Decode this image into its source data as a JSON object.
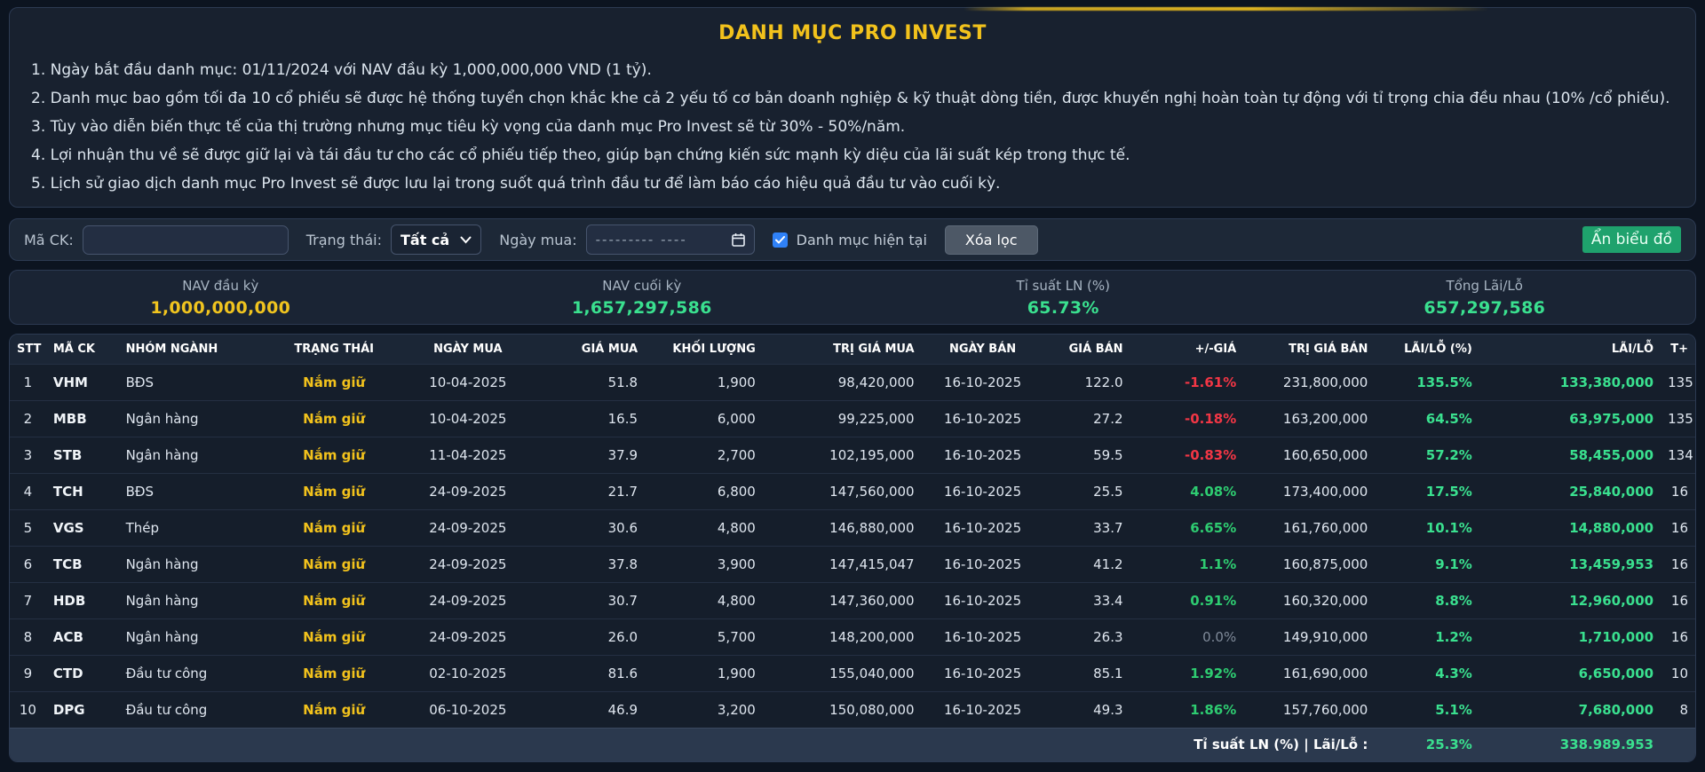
{
  "title": "DANH MỤC PRO INVEST",
  "notes": [
    "1. Ngày bắt đầu danh mục: 01/11/2024 với NAV đầu kỳ 1,000,000,000 VND (1 tỷ).",
    "2. Danh mục bao gồm tối đa 10 cổ phiếu sẽ được hệ thống tuyển chọn khắc khe cả 2 yếu tố cơ bản doanh nghiệp & kỹ thuật dòng tiền, được khuyến nghị hoàn toàn tự động với tỉ trọng chia đều nhau (10% /cổ phiếu).",
    "3. Tùy vào diễn biến thực tế của thị trường nhưng mục tiêu kỳ vọng của danh mục Pro Invest sẽ từ 30% - 50%/năm.",
    "4. Lợi nhuận thu về sẽ được giữ lại và tái đầu tư cho các cổ phiếu tiếp theo, giúp bạn chứng kiến sức mạnh kỳ diệu của lãi suất kép trong thực tế.",
    "5. Lịch sử giao dịch danh mục Pro Invest sẽ được lưu lại trong suốt quá trình đầu tư để làm báo cáo hiệu quả đầu tư vào cuối kỳ."
  ],
  "filter": {
    "ticker_label": "Mã CK:",
    "ticker_value": "",
    "status_label": "Trạng thái:",
    "status_value": "Tất cả",
    "buy_date_label": "Ngày mua:",
    "buy_date_placeholder": "--------- ----",
    "checkbox_label": "Danh mục hiện tại",
    "checkbox_checked": true,
    "clear_button": "Xóa lọc",
    "hide_chart_button": "Ẩn biểu đồ"
  },
  "summary": [
    {
      "label": "NAV đầu kỳ",
      "value": "1,000,000,000",
      "color": "#f0c41f"
    },
    {
      "label": "NAV cuối kỳ",
      "value": "1,657,297,586",
      "color": "#3ae08f"
    },
    {
      "label": "Tỉ suất LN (%)",
      "value": "65.73%",
      "color": "#3ae08f"
    },
    {
      "label": "Tổng Lãi/Lỗ",
      "value": "657,297,586",
      "color": "#3ae08f"
    }
  ],
  "table": {
    "headers": [
      "STT",
      "MÃ CK",
      "NHÓM NGÀNH",
      "TRẠNG THÁI",
      "NGÀY MUA",
      "GIÁ MUA",
      "KHỐI LƯỢNG",
      "TRỊ GIÁ MUA",
      "NGÀY BÁN",
      "GIÁ BÁN",
      "+/-GIÁ",
      "TRỊ GIÁ BÁN",
      "LÃI/LỖ (%)",
      "LÃI/LỖ",
      "T+"
    ],
    "rows": [
      [
        "1",
        "VHM",
        "BĐS",
        "Nắm giữ",
        "10-04-2025",
        "51.8",
        "1,900",
        "98,420,000",
        "16-10-2025",
        "122.0",
        "-1.61%",
        "231,800,000",
        "135.5%",
        "133,380,000",
        "135"
      ],
      [
        "2",
        "MBB",
        "Ngân hàng",
        "Nắm giữ",
        "10-04-2025",
        "16.5",
        "6,000",
        "99,225,000",
        "16-10-2025",
        "27.2",
        "-0.18%",
        "163,200,000",
        "64.5%",
        "63,975,000",
        "135"
      ],
      [
        "3",
        "STB",
        "Ngân hàng",
        "Nắm giữ",
        "11-04-2025",
        "37.9",
        "2,700",
        "102,195,000",
        "16-10-2025",
        "59.5",
        "-0.83%",
        "160,650,000",
        "57.2%",
        "58,455,000",
        "134"
      ],
      [
        "4",
        "TCH",
        "BĐS",
        "Nắm giữ",
        "24-09-2025",
        "21.7",
        "6,800",
        "147,560,000",
        "16-10-2025",
        "25.5",
        "4.08%",
        "173,400,000",
        "17.5%",
        "25,840,000",
        "16"
      ],
      [
        "5",
        "VGS",
        "Thép",
        "Nắm giữ",
        "24-09-2025",
        "30.6",
        "4,800",
        "146,880,000",
        "16-10-2025",
        "33.7",
        "6.65%",
        "161,760,000",
        "10.1%",
        "14,880,000",
        "16"
      ],
      [
        "6",
        "TCB",
        "Ngân hàng",
        "Nắm giữ",
        "24-09-2025",
        "37.8",
        "3,900",
        "147,415,047",
        "16-10-2025",
        "41.2",
        "1.1%",
        "160,875,000",
        "9.1%",
        "13,459,953",
        "16"
      ],
      [
        "7",
        "HDB",
        "Ngân hàng",
        "Nắm giữ",
        "24-09-2025",
        "30.7",
        "4,800",
        "147,360,000",
        "16-10-2025",
        "33.4",
        "0.91%",
        "160,320,000",
        "8.8%",
        "12,960,000",
        "16"
      ],
      [
        "8",
        "ACB",
        "Ngân hàng",
        "Nắm giữ",
        "24-09-2025",
        "26.0",
        "5,700",
        "148,200,000",
        "16-10-2025",
        "26.3",
        "0.0%",
        "149,910,000",
        "1.2%",
        "1,710,000",
        "16"
      ],
      [
        "9",
        "CTD",
        "Đầu tư công",
        "Nắm giữ",
        "02-10-2025",
        "81.6",
        "1,900",
        "155,040,000",
        "16-10-2025",
        "85.1",
        "1.92%",
        "161,690,000",
        "4.3%",
        "6,650,000",
        "10"
      ],
      [
        "10",
        "DPG",
        "Đầu tư công",
        "Nắm giữ",
        "06-10-2025",
        "46.9",
        "3,200",
        "150,080,000",
        "16-10-2025",
        "49.3",
        "1.86%",
        "157,760,000",
        "5.1%",
        "7,680,000",
        "8"
      ]
    ],
    "footer": {
      "label": "Tỉ suất LN (%) | Lãi/Lỗ :",
      "pct": "25.3%",
      "value": "338.989.953"
    }
  }
}
